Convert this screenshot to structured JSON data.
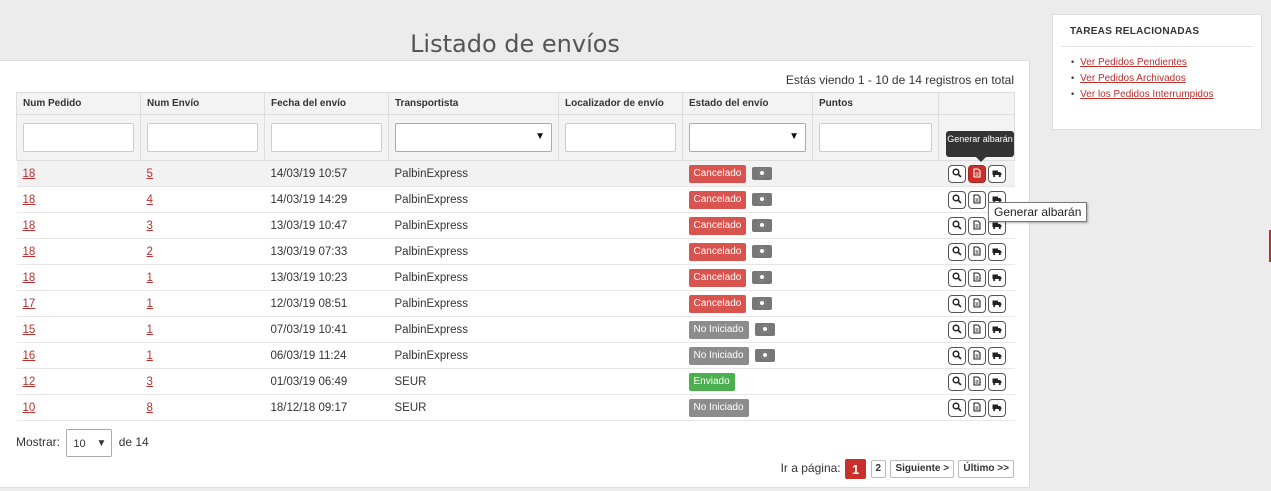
{
  "page": {
    "title": "Listado de envíos"
  },
  "records_info": "Estás viendo 1 - 10 de 14 registros en total",
  "table": {
    "headers": [
      "Num Pedido",
      "Num Envío",
      "Fecha del envío",
      "Transportista",
      "Localizador de envío",
      "Estado del envío",
      "Puntos"
    ],
    "rows": [
      {
        "pedido": "18",
        "envio": "5",
        "fecha": "14/03/19 10:57",
        "transportista": "PalbinExpress",
        "estado": "Cancelado",
        "estado_color": "red",
        "eye": true
      },
      {
        "pedido": "18",
        "envio": "4",
        "fecha": "14/03/19 14:29",
        "transportista": "PalbinExpress",
        "estado": "Cancelado",
        "estado_color": "red",
        "eye": true
      },
      {
        "pedido": "18",
        "envio": "3",
        "fecha": "13/03/19 10:47",
        "transportista": "PalbinExpress",
        "estado": "Cancelado",
        "estado_color": "red",
        "eye": true
      },
      {
        "pedido": "18",
        "envio": "2",
        "fecha": "13/03/19 07:33",
        "transportista": "PalbinExpress",
        "estado": "Cancelado",
        "estado_color": "red",
        "eye": true
      },
      {
        "pedido": "18",
        "envio": "1",
        "fecha": "13/03/19 10:23",
        "transportista": "PalbinExpress",
        "estado": "Cancelado",
        "estado_color": "red",
        "eye": true
      },
      {
        "pedido": "17",
        "envio": "1",
        "fecha": "12/03/19 08:51",
        "transportista": "PalbinExpress",
        "estado": "Cancelado",
        "estado_color": "red",
        "eye": true
      },
      {
        "pedido": "15",
        "envio": "1",
        "fecha": "07/03/19 10:41",
        "transportista": "PalbinExpress",
        "estado": "No Iniciado",
        "estado_color": "grey",
        "eye": true
      },
      {
        "pedido": "16",
        "envio": "1",
        "fecha": "06/03/19 11:24",
        "transportista": "PalbinExpress",
        "estado": "No Iniciado",
        "estado_color": "grey",
        "eye": true
      },
      {
        "pedido": "12",
        "envio": "3",
        "fecha": "01/03/19 06:49",
        "transportista": "SEUR",
        "estado": "Enviado",
        "estado_color": "green",
        "eye": false
      },
      {
        "pedido": "10",
        "envio": "8",
        "fecha": "18/12/18 09:17",
        "transportista": "SEUR",
        "estado": "No Iniciado",
        "estado_color": "grey",
        "eye": false
      }
    ]
  },
  "tooltips": {
    "dark": "Generar albarán",
    "light": "Generar albarán"
  },
  "show": {
    "label": "Mostrar:",
    "value": "10",
    "suffix": "de 14"
  },
  "pager": {
    "label": "Ir a página:",
    "pages": [
      "1",
      "2"
    ],
    "current": "1",
    "next": "Siguiente >",
    "last": "Último >>"
  },
  "side": {
    "title": "TAREAS RELACIONADAS",
    "links": [
      "Ver Pedidos Pendientes",
      "Ver Pedidos Archivados",
      "Ver los Pedidos Interrumpidos"
    ]
  },
  "colors": {
    "accent": "#c9302c",
    "badge_red": "#d9534f",
    "badge_grey": "#8c8c8c",
    "badge_green": "#4caf50"
  },
  "icons": {
    "view": "search-icon",
    "albaran": "document-icon",
    "shipping": "truck-icon",
    "eye": "eye-icon"
  }
}
